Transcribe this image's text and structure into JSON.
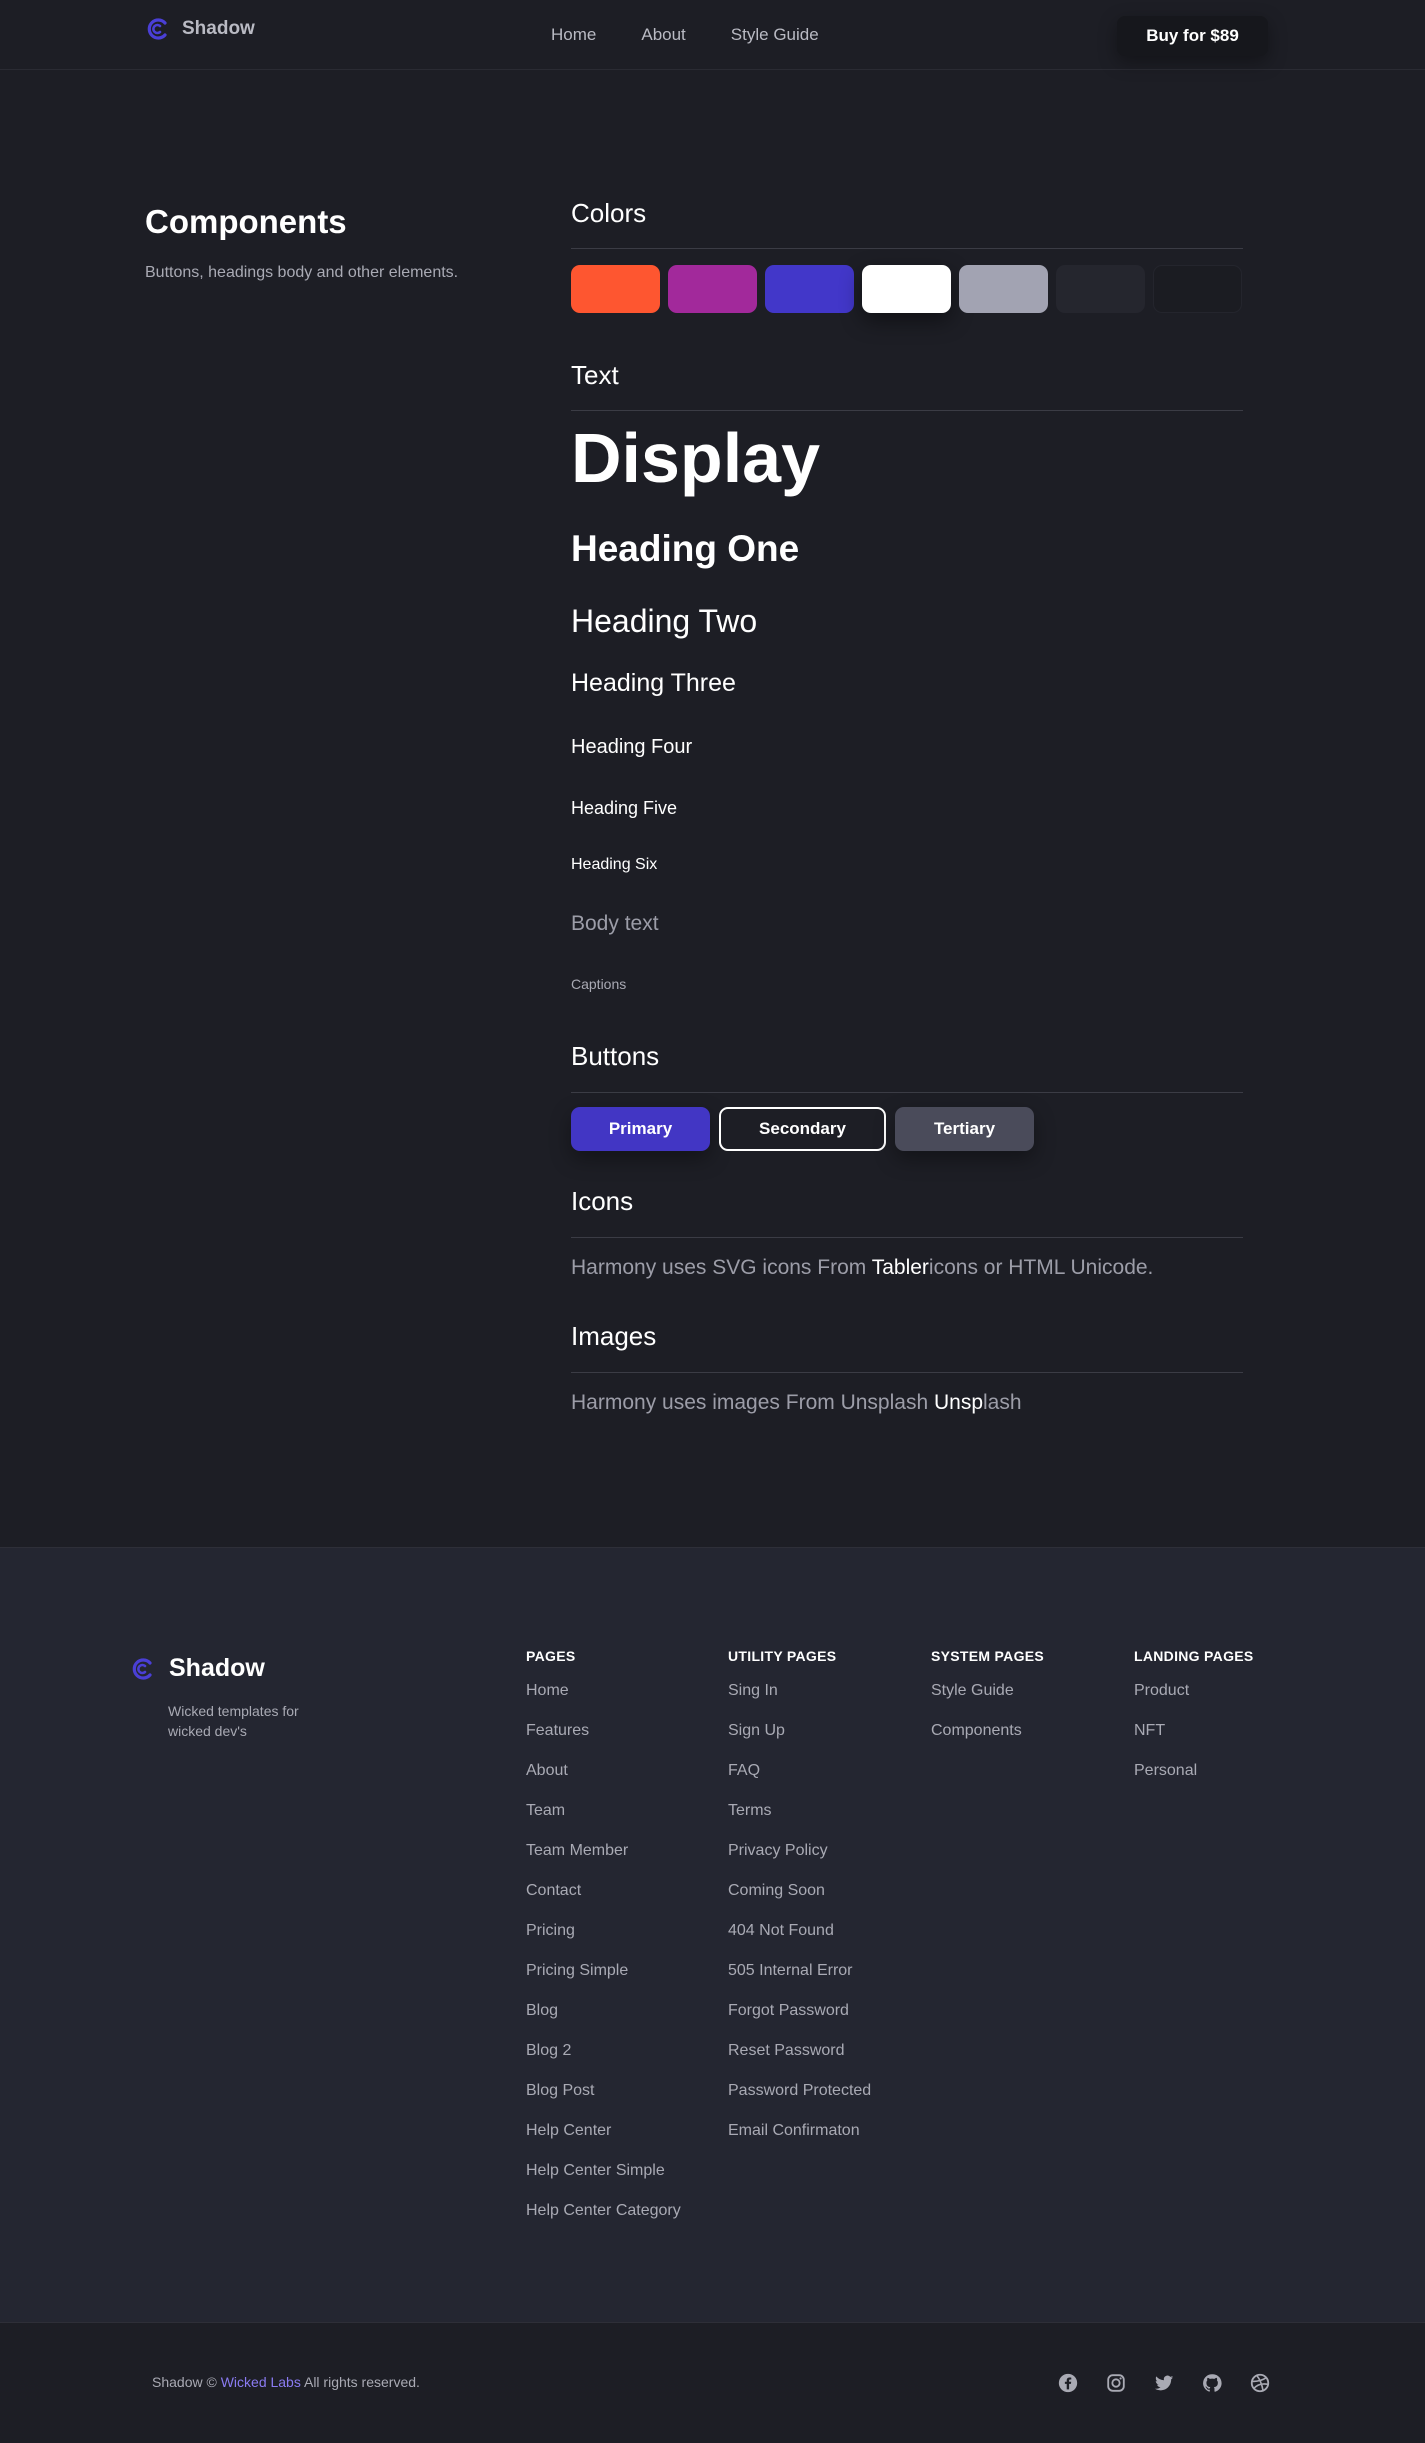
{
  "nav": {
    "brand": "Shadow",
    "links": [
      "Home",
      "About",
      "Style Guide"
    ],
    "buy_label": "Buy for $89"
  },
  "intro": {
    "title": "Components",
    "subtitle": "Buttons, headings body and other elements."
  },
  "colors": {
    "title": "Colors",
    "swatches": [
      "#fe5630",
      "#a2299b",
      "#4237c9",
      "#ffffff",
      "#a2a3b2",
      "#25262e",
      "#1b1c22"
    ]
  },
  "text": {
    "title": "Text",
    "display": "Display",
    "h1": "Heading One",
    "h2": "Heading Two",
    "h3": "Heading Three",
    "h4": "Heading Four",
    "h5": "Heading Five",
    "h6": "Heading Six",
    "body": "Body text",
    "caption": "Captions"
  },
  "buttons": {
    "title": "Buttons",
    "primary": "Primary",
    "secondary": "Secondary",
    "tertiary": "Tertiary"
  },
  "icons": {
    "title": "Icons",
    "text_before": "Harmony uses SVG icons From ",
    "highlight": "Tabler",
    "text_after": "icons or HTML Unicode."
  },
  "images": {
    "title": "Images",
    "text_before": "Harmony uses images From Unsplash ",
    "highlight": "Unsp",
    "text_after": "lash"
  },
  "footer": {
    "brand": "Shadow",
    "tagline": "Wicked templates for wicked dev's",
    "columns": [
      {
        "title": "PAGES",
        "links": [
          "Home",
          "Features",
          "About",
          "Team",
          "Team Member",
          "Contact",
          "Pricing",
          "Pricing Simple",
          "Blog",
          "Blog 2",
          "Blog Post",
          "Help Center",
          "Help Center Simple",
          "Help Center Category"
        ]
      },
      {
        "title": "UTILITY PAGES",
        "links": [
          "Sing In",
          "Sign Up",
          "FAQ",
          "Terms",
          "Privacy Policy",
          "Coming Soon",
          "404 Not Found",
          "505 Internal Error",
          "Forgot Password",
          "Reset Password",
          "Password Protected",
          "Email Confirmaton"
        ]
      },
      {
        "title": "SYSTEM PAGES",
        "links": [
          "Style Guide",
          "Components"
        ]
      },
      {
        "title": "LANDING PAGES",
        "links": [
          "Product",
          "NFT",
          "Personal"
        ]
      }
    ],
    "copyright_prefix": "Shadow ©",
    "copyright_link": "Wicked Labs",
    "copyright_suffix": "All rights reserved.",
    "social_icons": [
      "facebook-icon",
      "instagram-icon",
      "twitter-icon",
      "github-icon",
      "dribbble-icon"
    ]
  },
  "accent_color": "#4236c4"
}
